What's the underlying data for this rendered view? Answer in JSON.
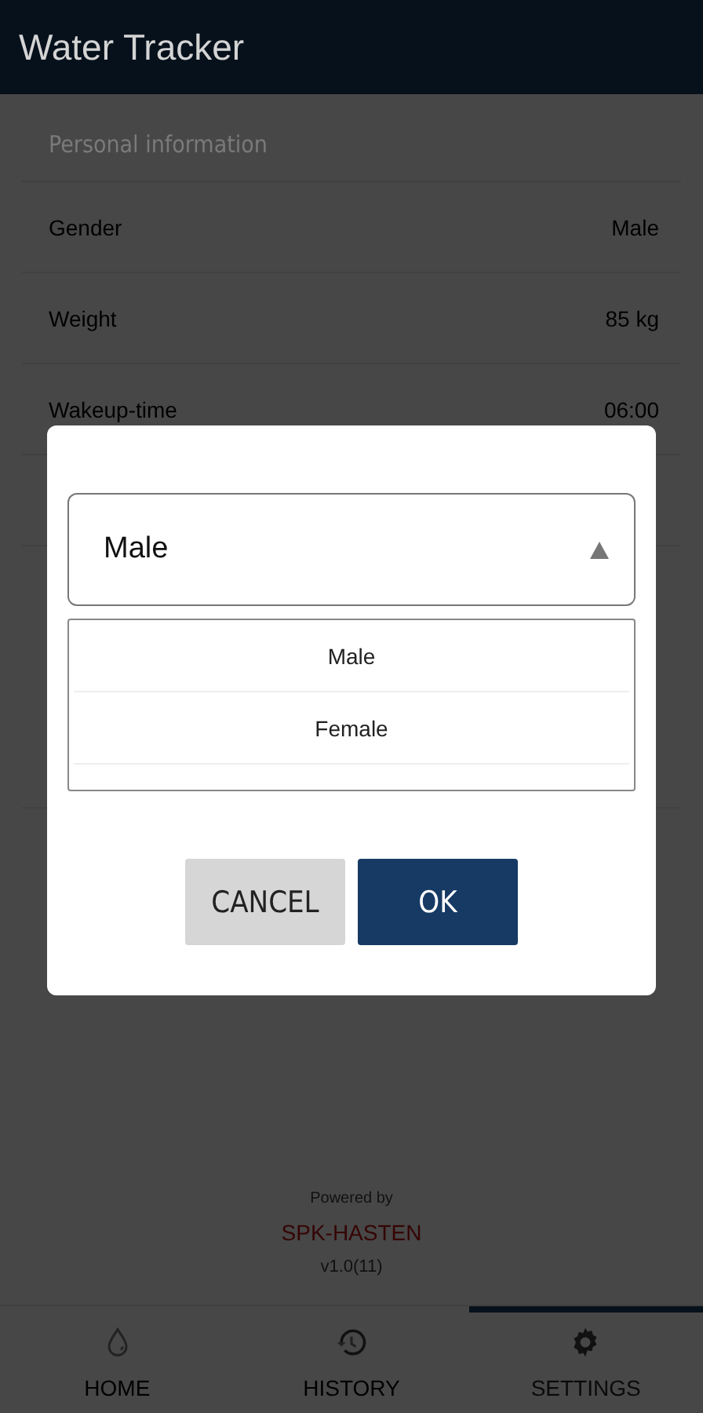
{
  "app_bar": {
    "title": "Water Tracker"
  },
  "settings": {
    "section_title": "Personal information",
    "rows": [
      {
        "label": "Gender",
        "value": "Male"
      },
      {
        "label": "Weight",
        "value": "85  kg"
      },
      {
        "label": "Wakeup-time",
        "value": "06:00"
      }
    ]
  },
  "footer": {
    "powered_by": "Powered by",
    "brand": "SPK-HASTEN",
    "version": "v1.0(11)"
  },
  "bottom_nav": [
    {
      "label": "HOME",
      "kind": "home",
      "selected": false
    },
    {
      "label": "HISTORY",
      "kind": "history",
      "selected": false
    },
    {
      "label": "SETTINGS",
      "kind": "settings",
      "selected": true
    }
  ],
  "dialog": {
    "dropdown": {
      "value": "Male",
      "expanded": true
    },
    "options": [
      {
        "label": "Male"
      },
      {
        "label": "Female"
      }
    ],
    "buttons": [
      {
        "label": "CANCEL",
        "kind": "secondary"
      },
      {
        "label": "OK",
        "kind": "primary"
      }
    ]
  }
}
